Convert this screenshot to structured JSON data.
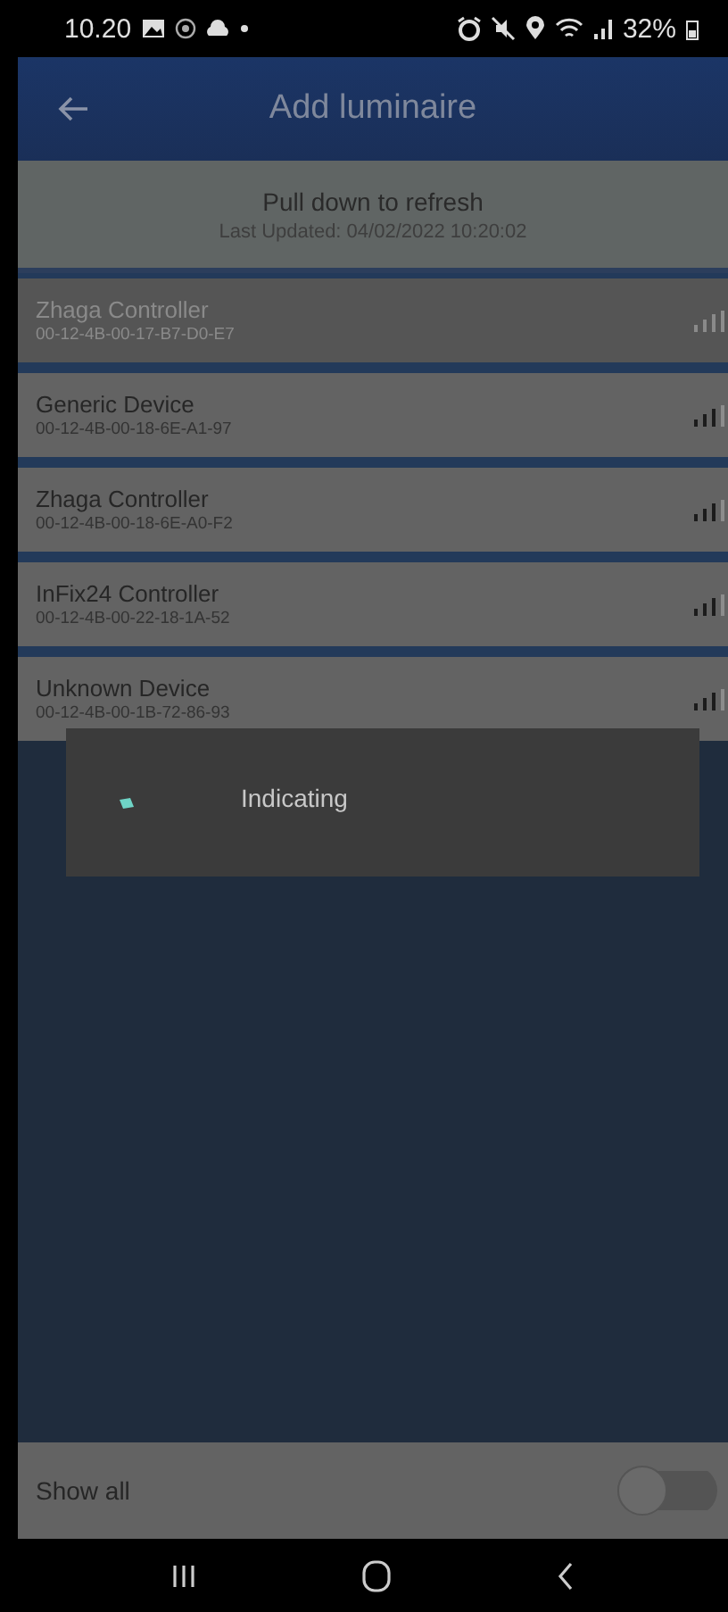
{
  "status_bar": {
    "time": "10.20",
    "battery": "32%"
  },
  "app_bar": {
    "title": "Add luminaire"
  },
  "refresh_header": {
    "title": "Pull down to refresh",
    "last_updated": "Last Updated: 04/02/2022 10:20:02"
  },
  "devices": [
    {
      "name": "Zhaga Controller",
      "address": "00-12-4B-00-17-B7-D0-E7",
      "disabled": true
    },
    {
      "name": "Generic Device",
      "address": "00-12-4B-00-18-6E-A1-97",
      "disabled": false
    },
    {
      "name": "Zhaga Controller",
      "address": "00-12-4B-00-18-6E-A0-F2",
      "disabled": false
    },
    {
      "name": "InFix24 Controller",
      "address": "00-12-4B-00-22-18-1A-52",
      "disabled": false
    },
    {
      "name": "Unknown Device",
      "address": "00-12-4B-00-1B-72-86-93",
      "disabled": false
    }
  ],
  "progress_dialog": {
    "message": "Indicating"
  },
  "footer": {
    "label": "Show all",
    "on": false
  }
}
